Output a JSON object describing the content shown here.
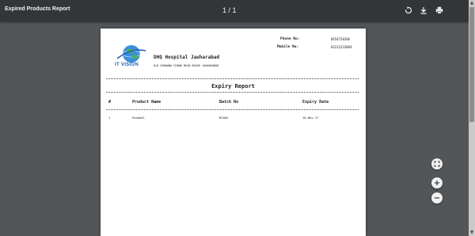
{
  "toolbar": {
    "title": "Expired Products Report",
    "page_counter": "1 / 1",
    "icons": [
      "rotate-icon",
      "download-icon",
      "print-icon"
    ]
  },
  "report": {
    "logo_text": "IT VISION",
    "hospital_name": "DHQ Hospital Jauharabad",
    "address": "OLD SARWANA CHOWK MAIN BAZAR JAUHARABAD",
    "phone_label": "Phone No:",
    "phone_value": "0454720206",
    "mobile_label": "Mobile No:",
    "mobile_value": "03212233069",
    "title": "Expiry Report",
    "columns": [
      "#",
      "Product Name",
      "Batch No",
      "Expiry Date"
    ],
    "rows": [
      [
        "1",
        "Panadol",
        "B2002",
        "18-Nov-17"
      ]
    ]
  },
  "viewer_controls": {
    "fit_icon": "fit-to-page-icon",
    "zoom_in": "+",
    "zoom_out": "−"
  },
  "colors": {
    "toolbar": "#323639",
    "viewer_background": "#525659",
    "logo_blue": "#1d5fb3",
    "logo_green": "#4caf50"
  }
}
